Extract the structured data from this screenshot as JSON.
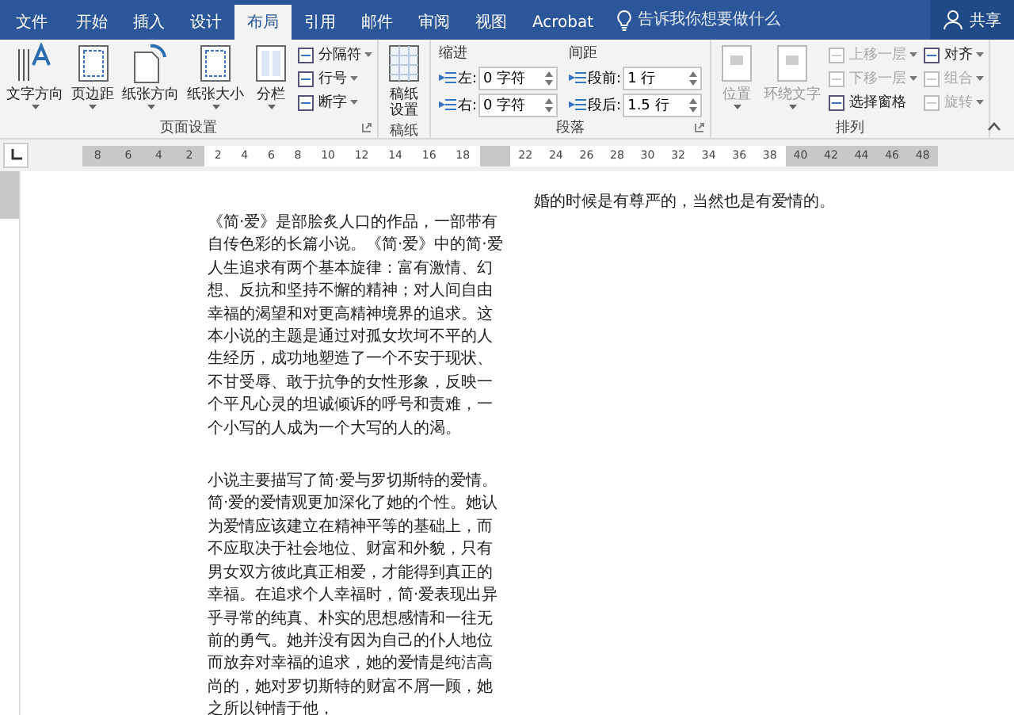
{
  "tabs": [
    {
      "label": "文件",
      "selected": false
    },
    {
      "label": "开始",
      "selected": false
    },
    {
      "label": "插入",
      "selected": false
    },
    {
      "label": "设计",
      "selected": false
    },
    {
      "label": "布局",
      "selected": true
    },
    {
      "label": "引用",
      "selected": false
    },
    {
      "label": "邮件",
      "selected": false
    },
    {
      "label": "审阅",
      "selected": false
    },
    {
      "label": "视图",
      "selected": false
    },
    {
      "label": "Acrobat",
      "selected": false
    }
  ],
  "tell_me": {
    "placeholder": "告诉我你想要做什么"
  },
  "share_button": "共享",
  "ribbon": {
    "groups": [
      {
        "label": "页面设置",
        "launcher": true,
        "items": [
          {
            "kind": "large",
            "label": "文字方向",
            "disabled": false,
            "dropdown": true
          },
          {
            "kind": "large",
            "label": "页边距",
            "disabled": false,
            "dropdown": true
          },
          {
            "kind": "large",
            "label": "纸张方向",
            "disabled": false,
            "dropdown": true
          },
          {
            "kind": "large",
            "label": "纸张大小",
            "disabled": false,
            "dropdown": true
          },
          {
            "kind": "large",
            "label": "分栏",
            "disabled": false,
            "dropdown": true
          },
          {
            "kind": "stack",
            "buttons": [
              {
                "label": "分隔符",
                "disabled": false,
                "dropdown": true
              },
              {
                "label": "行号",
                "disabled": false,
                "dropdown": true
              },
              {
                "label": "断字",
                "disabled": false,
                "dropdown": true
              }
            ]
          }
        ]
      },
      {
        "label": "稿纸",
        "launcher": false,
        "items": [
          {
            "kind": "large",
            "label": "稿纸设置",
            "disabled": false,
            "dropdown": false
          }
        ]
      },
      {
        "label": "段落",
        "launcher": true,
        "items": [
          {
            "kind": "spin",
            "title": "缩进",
            "fields": [
              {
                "label": "左:",
                "value": "0 字符"
              },
              {
                "label": "右:",
                "value": "0 字符"
              }
            ]
          },
          {
            "kind": "spin",
            "title": "间距",
            "fields": [
              {
                "label": "段前:",
                "value": "1 行"
              },
              {
                "label": "段后:",
                "value": "1.5 行"
              }
            ]
          }
        ]
      },
      {
        "label": "排列",
        "launcher": false,
        "items": [
          {
            "kind": "large",
            "label": "位置",
            "disabled": true,
            "dropdown": true
          },
          {
            "kind": "large",
            "label": "环绕文字",
            "disabled": true,
            "dropdown": true
          },
          {
            "kind": "stack",
            "buttons": [
              {
                "label": "上移一层",
                "disabled": true,
                "dropdown": true
              },
              {
                "label": "下移一层",
                "disabled": true,
                "dropdown": true
              },
              {
                "label": "选择窗格",
                "disabled": false,
                "dropdown": false
              }
            ]
          },
          {
            "kind": "stack",
            "buttons": [
              {
                "label": "对齐",
                "disabled": false,
                "dropdown": true
              },
              {
                "label": "组合",
                "disabled": true,
                "dropdown": true
              },
              {
                "label": "旋转",
                "disabled": true,
                "dropdown": true
              }
            ]
          }
        ]
      }
    ]
  },
  "ruler": {
    "segments": [
      {
        "margin": true,
        "labels": [
          "8",
          "6",
          "4",
          "2"
        ]
      },
      {
        "margin": false,
        "labels": [
          "2",
          "4",
          "6",
          "8",
          "10",
          "12",
          "14",
          "16",
          "18"
        ]
      },
      {
        "margin": true
      },
      {
        "margin": false,
        "labels": [
          "22",
          "24",
          "26",
          "28",
          "30",
          "32",
          "34",
          "36",
          "38"
        ]
      },
      {
        "margin": true,
        "labels": [
          "40",
          "42",
          "44",
          "46",
          "48"
        ]
      }
    ]
  },
  "document": {
    "columns": [
      {
        "paragraphs": [
          "《简·爱》是部脍炙人口的作品，一部带有自传色彩的长篇小说。《简·爱》中的简·爱人生追求有两个基本旋律：富有激情、幻想、反抗和坚持不懈的精神；对人间自由幸福的渴望和对更高精神境界的追求。这本小说的主题是通过对孤女坎坷不平的人生经历，成功地塑造了一个不安于现状、不甘受辱、敢于抗争的女性形象，反映一个平凡心灵的坦诚倾诉的呼号和责难，一个小写的人成为一个大写的人的渴。",
          "小说主要描写了简·爱与罗切斯特的爱情。简·爱的爱情观更加深化了她的个性。她认为爱情应该建立在精神平等的基础上，而不应取决于社会地位、财富和外貌，只有男女双方彼此真正相爱，才能得到真正的幸福。在追求个人幸福时，简·爱表现出异乎寻常的纯真、朴实的思想感情和一往无前的勇气。她并没有因为自己的仆人地位而放弃对幸福的追求，她的爱情是纯洁高尚的，她对罗切斯特的财富不屑一顾，她之所以钟情于他，"
        ]
      },
      {
        "paragraphs": [
          "婚的时候是有尊严的，当然也是有爱情的。"
        ]
      }
    ]
  }
}
